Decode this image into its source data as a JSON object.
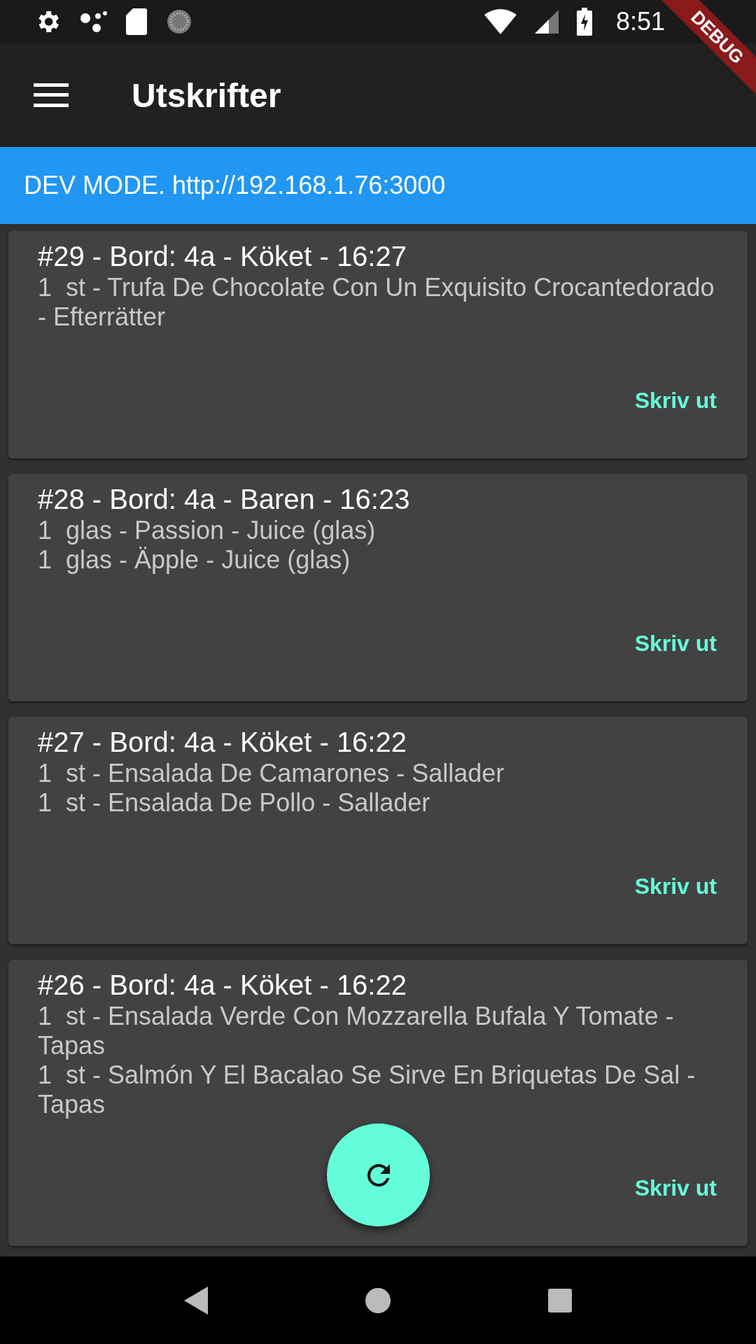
{
  "status_bar": {
    "time": "8:51"
  },
  "debug_banner": {
    "label": "DEBUG"
  },
  "app_bar": {
    "title": "Utskrifter"
  },
  "dev_banner": {
    "text": "DEV MODE. http://192.168.1.76:3000"
  },
  "orders": [
    {
      "title": "#29 - Bord: 4a - Köket - 16:27",
      "items": [
        "1  st - Trufa De Chocolate Con Un Exquisito Crocantedorado - Efterrätter"
      ],
      "action": "Skriv ut"
    },
    {
      "title": "#28 - Bord: 4a - Baren - 16:23",
      "items": [
        "1  glas - Passion - Juice (glas)",
        "1  glas - Äpple - Juice (glas)"
      ],
      "action": "Skriv ut"
    },
    {
      "title": "#27 - Bord: 4a - Köket - 16:22",
      "items": [
        "1  st - Ensalada De Camarones - Sallader",
        "1  st - Ensalada De Pollo - Sallader"
      ],
      "action": "Skriv ut"
    },
    {
      "title": "#26 - Bord: 4a - Köket - 16:22",
      "items": [
        "1  st - Ensalada Verde Con Mozzarella Bufala Y Tomate - Tapas",
        "1  st - Salmón Y El Bacalao Se Sirve En Briquetas De Sal - Tapas"
      ],
      "action": "Skriv ut"
    }
  ]
}
